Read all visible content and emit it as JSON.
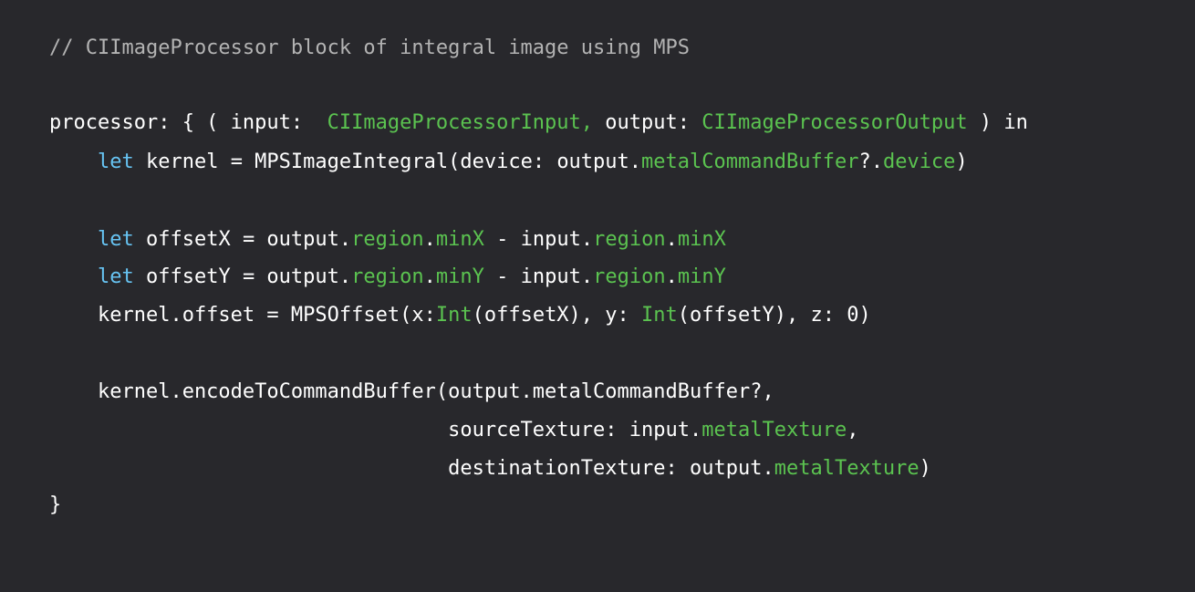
{
  "colors": {
    "background": "#28282c",
    "plain": "#ffffff",
    "comment": "#b3b3b3",
    "keyword": "#67c4f3",
    "type_or_property": "#5bc350"
  },
  "code": {
    "lines": [
      {
        "tokens": [
          {
            "t": "// CIImageProcessor block of integral image using MPS",
            "c": "comment"
          }
        ]
      },
      {
        "tokens": [
          {
            "t": "processor: { ( input:  ",
            "c": "plain"
          },
          {
            "t": "CIImageProcessorInput,",
            "c": "green"
          },
          {
            "t": " output: ",
            "c": "plain"
          },
          {
            "t": "CIImageProcessorOutput",
            "c": "green"
          },
          {
            "t": " ) in",
            "c": "plain"
          }
        ]
      },
      {
        "tokens": [
          {
            "t": "    ",
            "c": "plain"
          },
          {
            "t": "let",
            "c": "kw"
          },
          {
            "t": " kernel = MPSImageIntegral(device: output.",
            "c": "plain"
          },
          {
            "t": "metalCommandBuffer",
            "c": "green"
          },
          {
            "t": "?.",
            "c": "plain"
          },
          {
            "t": "device",
            "c": "green"
          },
          {
            "t": ")",
            "c": "plain"
          }
        ]
      },
      {
        "tokens": [
          {
            "t": "    ",
            "c": "plain"
          },
          {
            "t": "let",
            "c": "kw"
          },
          {
            "t": " offsetX = output.",
            "c": "plain"
          },
          {
            "t": "region",
            "c": "green"
          },
          {
            "t": ".",
            "c": "plain"
          },
          {
            "t": "minX",
            "c": "green"
          },
          {
            "t": " - input.",
            "c": "plain"
          },
          {
            "t": "region",
            "c": "green"
          },
          {
            "t": ".",
            "c": "plain"
          },
          {
            "t": "minX",
            "c": "green"
          }
        ]
      },
      {
        "tokens": [
          {
            "t": "    ",
            "c": "plain"
          },
          {
            "t": "let",
            "c": "kw"
          },
          {
            "t": " offsetY = output.",
            "c": "plain"
          },
          {
            "t": "region",
            "c": "green"
          },
          {
            "t": ".",
            "c": "plain"
          },
          {
            "t": "minY",
            "c": "green"
          },
          {
            "t": " - input.",
            "c": "plain"
          },
          {
            "t": "region",
            "c": "green"
          },
          {
            "t": ".",
            "c": "plain"
          },
          {
            "t": "minY",
            "c": "green"
          }
        ]
      },
      {
        "tokens": [
          {
            "t": "    kernel.offset = MPSOffset(x:",
            "c": "plain"
          },
          {
            "t": "Int",
            "c": "green"
          },
          {
            "t": "(offsetX), y: ",
            "c": "plain"
          },
          {
            "t": "Int",
            "c": "green"
          },
          {
            "t": "(offsetY), z: 0)",
            "c": "plain"
          }
        ]
      },
      {
        "tokens": [
          {
            "t": "    kernel.encodeToCommandBuffer(output.metalCommandBuffer?,",
            "c": "plain"
          }
        ]
      },
      {
        "tokens": [
          {
            "t": "                                 sourceTexture: input.",
            "c": "plain"
          },
          {
            "t": "metalTexture",
            "c": "green"
          },
          {
            "t": ",",
            "c": "plain"
          }
        ]
      },
      {
        "tokens": [
          {
            "t": "                                 destinationTexture: output.",
            "c": "plain"
          },
          {
            "t": "metalTexture",
            "c": "green"
          },
          {
            "t": ")",
            "c": "plain"
          }
        ]
      },
      {
        "tokens": [
          {
            "t": "}",
            "c": "plain"
          }
        ]
      }
    ]
  }
}
